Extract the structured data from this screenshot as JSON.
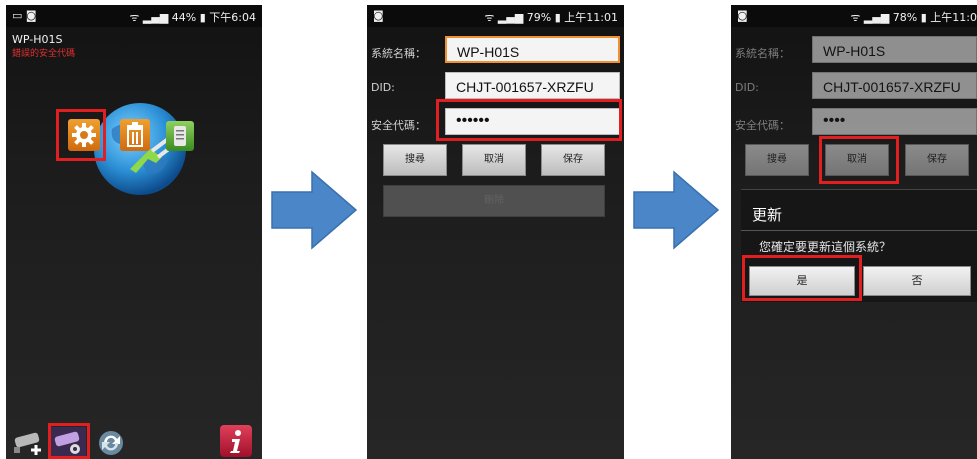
{
  "phone1": {
    "status_left": "▭ ◙",
    "status_right": "ᯤ ▂▄▆ 44% ▮ 下午6:04",
    "device_name": "WP-H01S",
    "warning": "錯誤的安全代碼"
  },
  "phone2": {
    "status_left": "◙",
    "status_right": "ᯤ ▂▄▆ 79% ▮ 上午11:01",
    "labels": {
      "name": "系統名稱：",
      "did": "DID:",
      "code": "安全代碼："
    },
    "values": {
      "name": "WP-H01S",
      "did": "CHJT-001657-XRZFU",
      "code": "••••••"
    },
    "buttons": {
      "search": "搜尋",
      "cancel": "取消",
      "save": "保存",
      "delete": "刪除"
    }
  },
  "phone3": {
    "status_left": "◙",
    "status_right": "ᯤ ▂▄▆ 78% ▮ 上午11:0",
    "labels": {
      "name": "系統名稱：",
      "did": "DID:",
      "code": "安全代碼："
    },
    "values": {
      "name": "WP-H01S",
      "did": "CHJT-001657-XRZFU",
      "code": "••••"
    },
    "buttons": {
      "search": "搜尋",
      "cancel": "取消",
      "save": "保存"
    },
    "dialog": {
      "title": "更新",
      "message": "您確定要更新這個系統？",
      "yes": "是",
      "no": "否"
    }
  },
  "colors": {
    "highlight": "#e02020",
    "arrow": "#4a86c8"
  }
}
